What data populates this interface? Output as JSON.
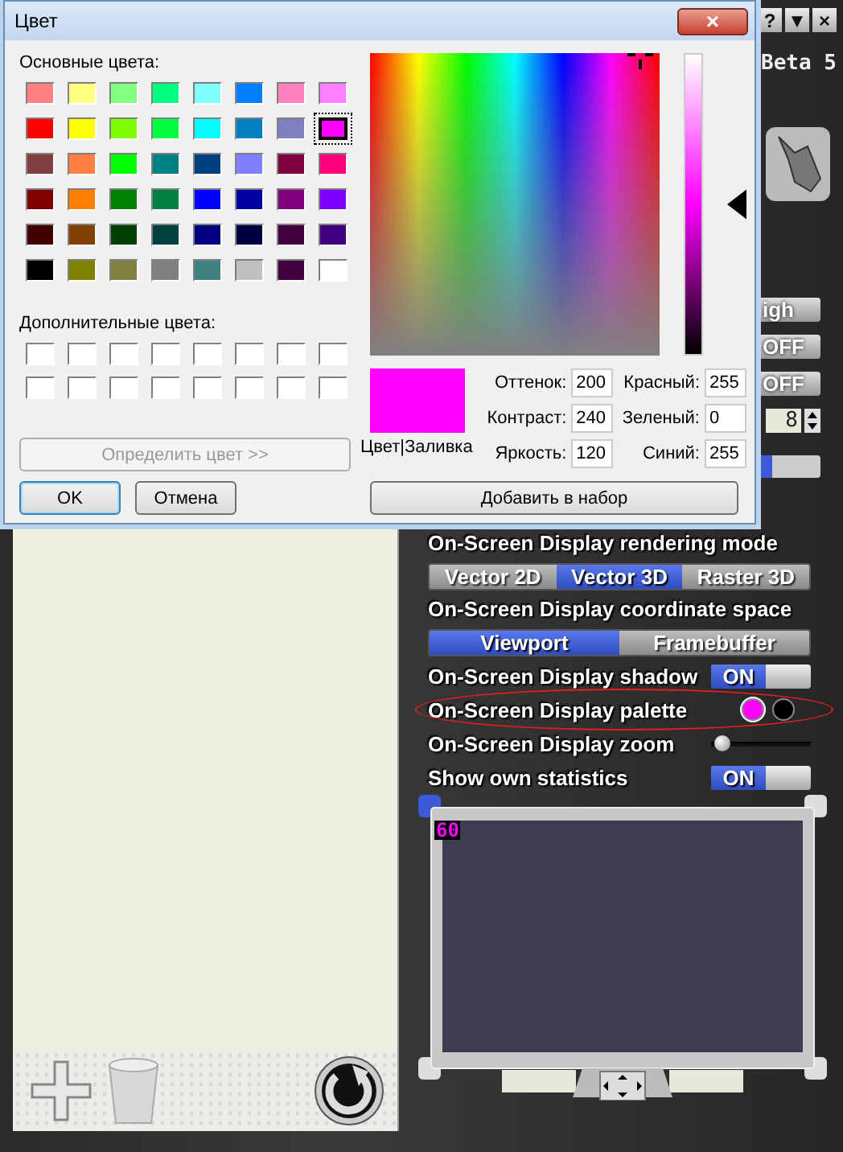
{
  "dialog": {
    "title": "Цвет",
    "close": "×",
    "basic_label": "Основные цвета:",
    "basic_colors": [
      {
        "color": "#ff8080",
        "selected": false
      },
      {
        "color": "#ffff80",
        "selected": false
      },
      {
        "color": "#80ff80",
        "selected": false
      },
      {
        "color": "#00ff80",
        "selected": false
      },
      {
        "color": "#80ffff",
        "selected": false
      },
      {
        "color": "#0080ff",
        "selected": false
      },
      {
        "color": "#ff80c0",
        "selected": false
      },
      {
        "color": "#ff80ff",
        "selected": false
      },
      {
        "color": "#ff0000",
        "selected": false
      },
      {
        "color": "#ffff00",
        "selected": false
      },
      {
        "color": "#80ff00",
        "selected": false
      },
      {
        "color": "#00ff40",
        "selected": false
      },
      {
        "color": "#00ffff",
        "selected": false
      },
      {
        "color": "#0080c0",
        "selected": false
      },
      {
        "color": "#8080c0",
        "selected": false
      },
      {
        "color": "#ff00ff",
        "selected": true
      },
      {
        "color": "#804040",
        "selected": false
      },
      {
        "color": "#ff8040",
        "selected": false
      },
      {
        "color": "#00ff00",
        "selected": false
      },
      {
        "color": "#008080",
        "selected": false
      },
      {
        "color": "#004080",
        "selected": false
      },
      {
        "color": "#8080ff",
        "selected": false
      },
      {
        "color": "#800040",
        "selected": false
      },
      {
        "color": "#ff0080",
        "selected": false
      },
      {
        "color": "#800000",
        "selected": false
      },
      {
        "color": "#ff8000",
        "selected": false
      },
      {
        "color": "#008000",
        "selected": false
      },
      {
        "color": "#008040",
        "selected": false
      },
      {
        "color": "#0000ff",
        "selected": false
      },
      {
        "color": "#0000a0",
        "selected": false
      },
      {
        "color": "#800080",
        "selected": false
      },
      {
        "color": "#8000ff",
        "selected": false
      },
      {
        "color": "#400000",
        "selected": false
      },
      {
        "color": "#804000",
        "selected": false
      },
      {
        "color": "#004000",
        "selected": false
      },
      {
        "color": "#004040",
        "selected": false
      },
      {
        "color": "#000080",
        "selected": false
      },
      {
        "color": "#000040",
        "selected": false
      },
      {
        "color": "#400040",
        "selected": false
      },
      {
        "color": "#400080",
        "selected": false
      },
      {
        "color": "#000000",
        "selected": false
      },
      {
        "color": "#808000",
        "selected": false
      },
      {
        "color": "#808040",
        "selected": false
      },
      {
        "color": "#808080",
        "selected": false
      },
      {
        "color": "#408080",
        "selected": false
      },
      {
        "color": "#c0c0c0",
        "selected": false
      },
      {
        "color": "#400040",
        "selected": false
      },
      {
        "color": "#ffffff",
        "selected": false
      }
    ],
    "custom_label": "Дополнительные цвета:",
    "custom_colors": [
      {
        "color": "#ffffff"
      },
      {
        "color": "#ffffff"
      },
      {
        "color": "#ffffff"
      },
      {
        "color": "#ffffff"
      },
      {
        "color": "#ffffff"
      },
      {
        "color": "#ffffff"
      },
      {
        "color": "#ffffff"
      },
      {
        "color": "#ffffff"
      },
      {
        "color": "#ffffff"
      },
      {
        "color": "#ffffff"
      },
      {
        "color": "#ffffff"
      },
      {
        "color": "#ffffff"
      },
      {
        "color": "#ffffff"
      },
      {
        "color": "#ffffff"
      },
      {
        "color": "#ffffff"
      },
      {
        "color": "#ffffff"
      }
    ],
    "define_button": {
      "label": "Определить цвет >>",
      "disabled": true
    },
    "ok_button": "OK",
    "cancel_button": "Отмена",
    "preview": {
      "color": "#ff00ff",
      "caption": "Цвет|Заливка"
    },
    "fields": [
      {
        "label": "Оттенок:",
        "value": "200"
      },
      {
        "label": "Красный:",
        "value": "255"
      },
      {
        "label": "Контраст:",
        "value": "240"
      },
      {
        "label": "Зеленый:",
        "value": "0"
      },
      {
        "label": "Яркость:",
        "value": "120"
      },
      {
        "label": "Синий:",
        "value": "255"
      }
    ],
    "add_button": "Добавить в набор"
  },
  "app": {
    "title_buttons": [
      "?",
      "▼",
      "×"
    ],
    "version": "Beta 5",
    "controls": [
      {
        "kind": "button",
        "label": "igh"
      },
      {
        "kind": "toggle",
        "label": "OFF",
        "on": false
      },
      {
        "kind": "toggle",
        "label": "OFF",
        "on": false
      },
      {
        "kind": "spinner",
        "label": "8"
      }
    ],
    "settings": [
      {
        "kind": "segmented",
        "label": "On-Screen Display rendering mode",
        "options": [
          {
            "label": "Vector 2D",
            "selected": false
          },
          {
            "label": "Vector 3D",
            "selected": true
          },
          {
            "label": "Raster 3D",
            "selected": false
          }
        ]
      },
      {
        "kind": "segmented",
        "label": "On-Screen Display coordinate space",
        "options": [
          {
            "label": "Viewport",
            "selected": true
          },
          {
            "label": "Framebuffer",
            "selected": false
          }
        ]
      },
      {
        "kind": "toggle",
        "label": "On-Screen Display shadow",
        "value": "ON",
        "on": true
      },
      {
        "kind": "palette",
        "label": "On-Screen Display palette",
        "highlighted": true,
        "colors": [
          {
            "color": "#ff00ff",
            "selected": true
          },
          {
            "color": "#000000",
            "selected": false
          }
        ]
      },
      {
        "kind": "slider",
        "label": "On-Screen Display zoom",
        "level": 0.04
      },
      {
        "kind": "toggle",
        "label": "Show own statistics",
        "value": "ON",
        "on": true
      }
    ],
    "preview": {
      "osd_text": "60"
    }
  }
}
